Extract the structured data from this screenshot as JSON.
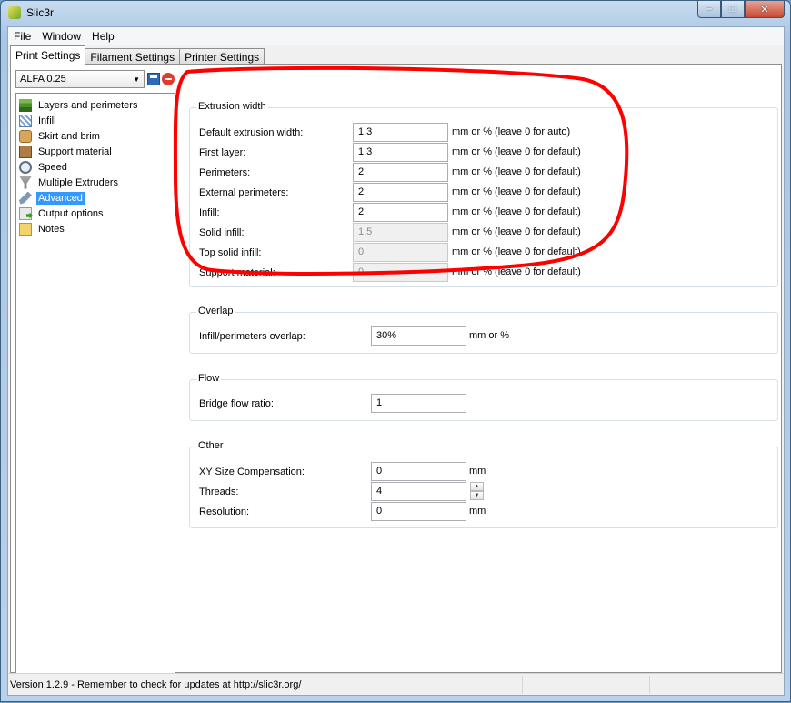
{
  "window": {
    "title": "Slic3r"
  },
  "menu": [
    "File",
    "Window",
    "Help"
  ],
  "tabs": [
    "Print Settings",
    "Filament Settings",
    "Printer Settings"
  ],
  "preset": {
    "selected": "ALFA 0.25"
  },
  "sidebar": {
    "items": [
      {
        "label": "Layers and perimeters",
        "icon": "layers-icon"
      },
      {
        "label": "Infill",
        "icon": "infill-icon"
      },
      {
        "label": "Skirt and brim",
        "icon": "skirt-icon"
      },
      {
        "label": "Support material",
        "icon": "support-icon"
      },
      {
        "label": "Speed",
        "icon": "speed-icon"
      },
      {
        "label": "Multiple Extruders",
        "icon": "extruders-icon"
      },
      {
        "label": "Advanced",
        "icon": "wrench-icon",
        "selected": true
      },
      {
        "label": "Output options",
        "icon": "output-icon"
      },
      {
        "label": "Notes",
        "icon": "notes-icon"
      }
    ]
  },
  "extrusion_width": {
    "title": "Extrusion width",
    "rows": [
      {
        "label": "Default extrusion width:",
        "value": "1.3",
        "side": "mm or % (leave 0 for auto)",
        "disabled": false
      },
      {
        "label": "First layer:",
        "value": "1.3",
        "side": "mm or % (leave 0 for default)",
        "disabled": false
      },
      {
        "label": "Perimeters:",
        "value": "2",
        "side": "mm or % (leave 0 for default)",
        "disabled": false
      },
      {
        "label": "External perimeters:",
        "value": "2",
        "side": "mm or % (leave 0 for default)",
        "disabled": false
      },
      {
        "label": "Infill:",
        "value": "2",
        "side": "mm or % (leave 0 for default)",
        "disabled": false
      },
      {
        "label": "Solid infill:",
        "value": "1.5",
        "side": "mm or % (leave 0 for default)",
        "disabled": true
      },
      {
        "label": "Top solid infill:",
        "value": "0",
        "side": "mm or % (leave 0 for default)",
        "disabled": true
      },
      {
        "label": "Support material:",
        "value": "0",
        "side": "mm or % (leave 0 for default)",
        "disabled": true
      }
    ]
  },
  "overlap": {
    "title": "Overlap",
    "label": "Infill/perimeters overlap:",
    "value": "30%",
    "side": "mm or %"
  },
  "flow": {
    "title": "Flow",
    "label": "Bridge flow ratio:",
    "value": "1"
  },
  "other": {
    "title": "Other",
    "xy_label": "XY Size Compensation:",
    "xy_value": "0",
    "xy_side": "mm",
    "threads_label": "Threads:",
    "threads_value": "4",
    "resolution_label": "Resolution:",
    "resolution_value": "0",
    "resolution_side": "mm"
  },
  "status": {
    "text": "Version 1.2.9 - Remember to check for updates at http://slic3r.org/"
  },
  "colors": {
    "annotation": "#ff0000",
    "selection": "#3399ff"
  }
}
